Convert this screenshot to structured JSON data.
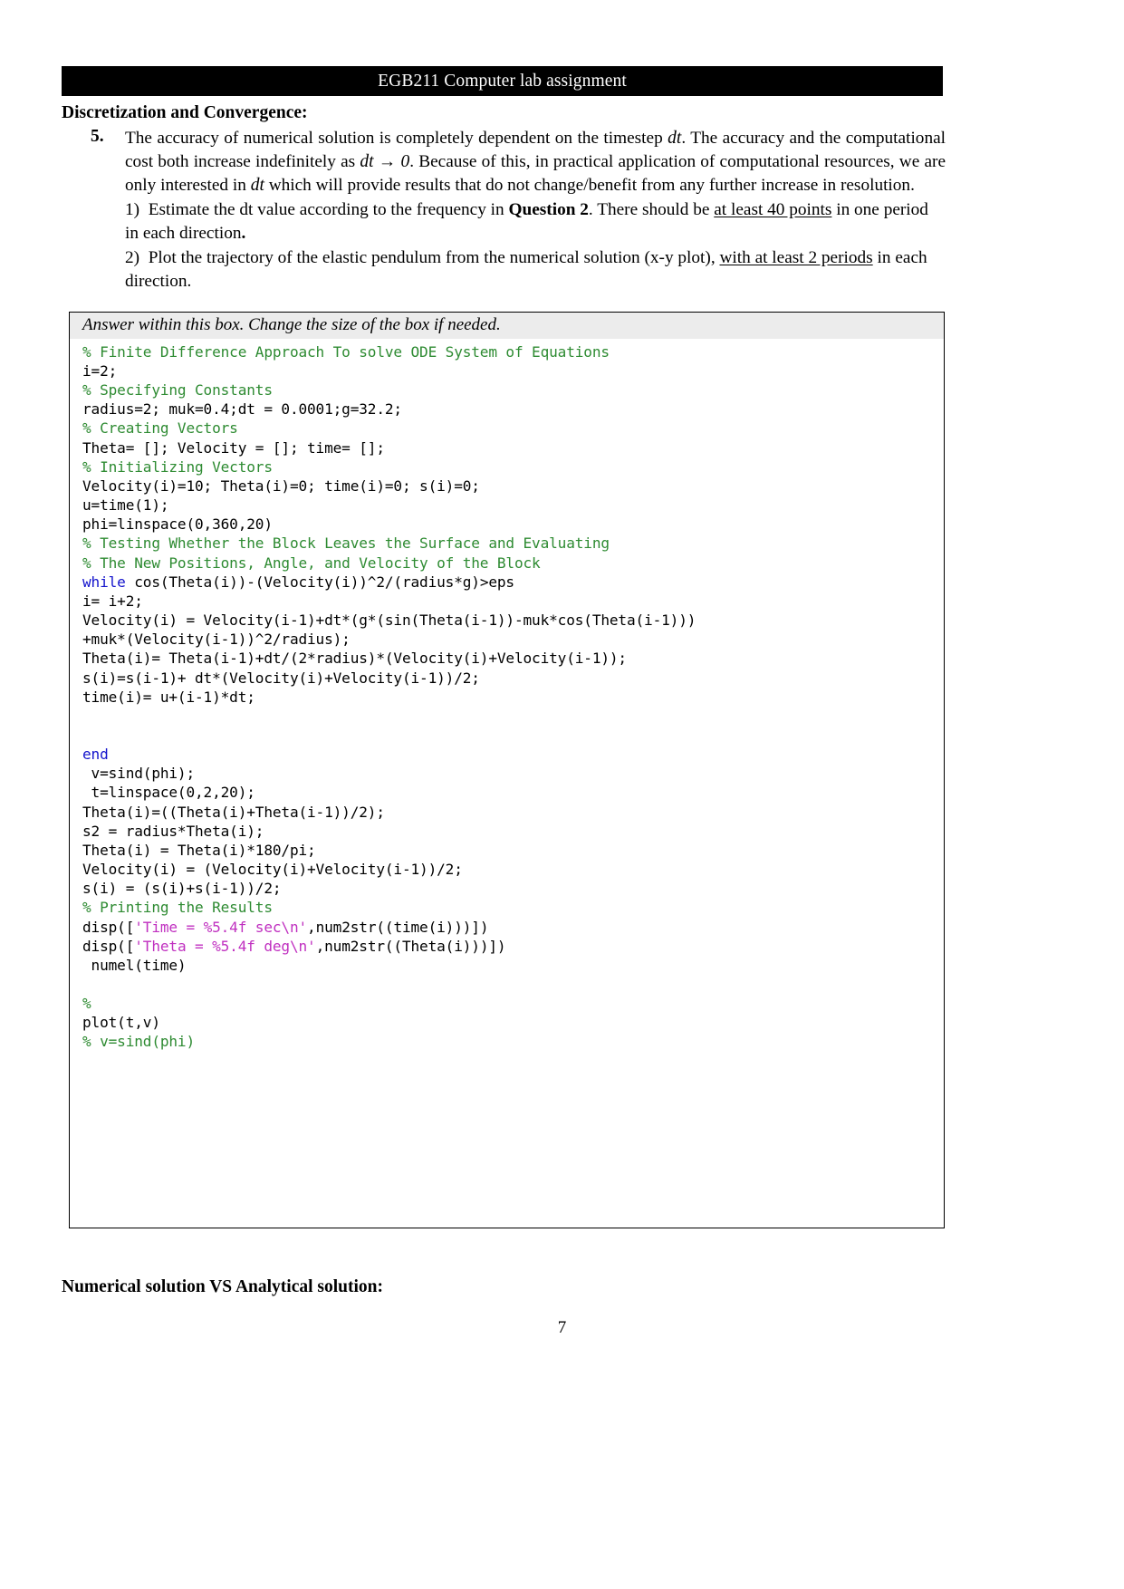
{
  "header": {
    "banner_title": "EGB211 Computer lab assignment"
  },
  "section": {
    "heading": "Discretization and Convergence:",
    "item_number": "5.",
    "paragraph_part1": "The accuracy of numerical solution is completely dependent on the timestep ",
    "math_dt_1": "dt",
    "paragraph_part2": ". The accuracy and the computational cost both increase indefinitely as ",
    "math_dt_arrow": "dt → 0",
    "paragraph_part3": ". Because of this, in practical application of computational resources, we are only interested in ",
    "math_dt_2": "dt",
    "paragraph_part4": " which will provide results that do not change/benefit from any further increase in resolution.",
    "sub_items": [
      {
        "marker": "1)",
        "text_a": "Estimate the dt value according to the frequency in ",
        "bold_a": "Question 2",
        "text_b": ". There should be ",
        "underline_a": "at least 40 points",
        "text_c": " in one period in each direction",
        "bold_b": "."
      },
      {
        "marker": "2)",
        "text_a": "Plot the trajectory of the elastic pendulum from the numerical solution (x-y plot), ",
        "underline_a": "with at least 2 periods",
        "text_b": " in each direction."
      }
    ]
  },
  "answer_box": {
    "prompt": "Answer within this box. Change the size of the box if needed.",
    "code_lines": [
      {
        "type": "comment",
        "text": "% Finite Difference Approach To solve ODE System of Equations"
      },
      {
        "type": "plain",
        "text": "i=2;"
      },
      {
        "type": "comment",
        "text": "% Specifying Constants"
      },
      {
        "type": "plain",
        "text": "radius=2; muk=0.4;dt = 0.0001;g=32.2;"
      },
      {
        "type": "comment",
        "text": "% Creating Vectors"
      },
      {
        "type": "plain",
        "text": "Theta= []; Velocity = []; time= [];"
      },
      {
        "type": "comment",
        "text": "% Initializing Vectors"
      },
      {
        "type": "plain",
        "text": "Velocity(i)=10; Theta(i)=0; time(i)=0; s(i)=0;"
      },
      {
        "type": "plain",
        "text": "u=time(1);"
      },
      {
        "type": "plain",
        "text": "phi=linspace(0,360,20)"
      },
      {
        "type": "comment",
        "text": "% Testing Whether the Block Leaves the Surface and Evaluating"
      },
      {
        "type": "comment",
        "text": "% The New Positions, Angle, and Velocity of the Block"
      },
      {
        "type": "keyword-lead",
        "keyword": "while",
        "text": " cos(Theta(i))-(Velocity(i))^2/(radius*g)>eps"
      },
      {
        "type": "plain",
        "text": "i= i+2;"
      },
      {
        "type": "plain",
        "text": "Velocity(i) = Velocity(i-1)+dt*(g*(sin(Theta(i-1))-muk*cos(Theta(i-1)))"
      },
      {
        "type": "plain",
        "text": "+muk*(Velocity(i-1))^2/radius);"
      },
      {
        "type": "plain",
        "text": "Theta(i)= Theta(i-1)+dt/(2*radius)*(Velocity(i)+Velocity(i-1));"
      },
      {
        "type": "plain",
        "text": "s(i)=s(i-1)+ dt*(Velocity(i)+Velocity(i-1))/2;"
      },
      {
        "type": "plain",
        "text": "time(i)= u+(i-1)*dt;"
      },
      {
        "type": "blank",
        "text": ""
      },
      {
        "type": "blank",
        "text": ""
      },
      {
        "type": "keyword",
        "text": "end"
      },
      {
        "type": "plain",
        "text": " v=sind(phi);"
      },
      {
        "type": "plain",
        "text": " t=linspace(0,2,20);"
      },
      {
        "type": "plain",
        "text": "Theta(i)=((Theta(i)+Theta(i-1))/2);"
      },
      {
        "type": "plain",
        "text": "s2 = radius*Theta(i);"
      },
      {
        "type": "plain",
        "text": "Theta(i) = Theta(i)*180/pi;"
      },
      {
        "type": "plain",
        "text": "Velocity(i) = (Velocity(i)+Velocity(i-1))/2;"
      },
      {
        "type": "plain",
        "text": "s(i) = (s(i)+s(i-1))/2;"
      },
      {
        "type": "comment",
        "text": "% Printing the Results"
      },
      {
        "type": "string-mid",
        "pre": "disp([",
        "str": "'Time = %5.4f sec\\n'",
        "post": ",num2str((time(i)))])"
      },
      {
        "type": "string-mid",
        "pre": "disp([",
        "str": "'Theta = %5.4f deg\\n'",
        "post": ",num2str((Theta(i)))])"
      },
      {
        "type": "plain",
        "text": " numel(time)"
      },
      {
        "type": "blank",
        "text": ""
      },
      {
        "type": "comment",
        "text": "%"
      },
      {
        "type": "plain",
        "text": "plot(t,v)"
      },
      {
        "type": "comment",
        "text": "% v=sind(phi)"
      }
    ]
  },
  "footer": {
    "label": "Numerical solution VS Analytical solution:",
    "page_number": "7"
  },
  "colors": {
    "comment": "#2e8b32",
    "keyword": "#1414cc",
    "string": "#c030c0",
    "banner_bg": "#000000",
    "prompt_bg": "#ececec"
  }
}
